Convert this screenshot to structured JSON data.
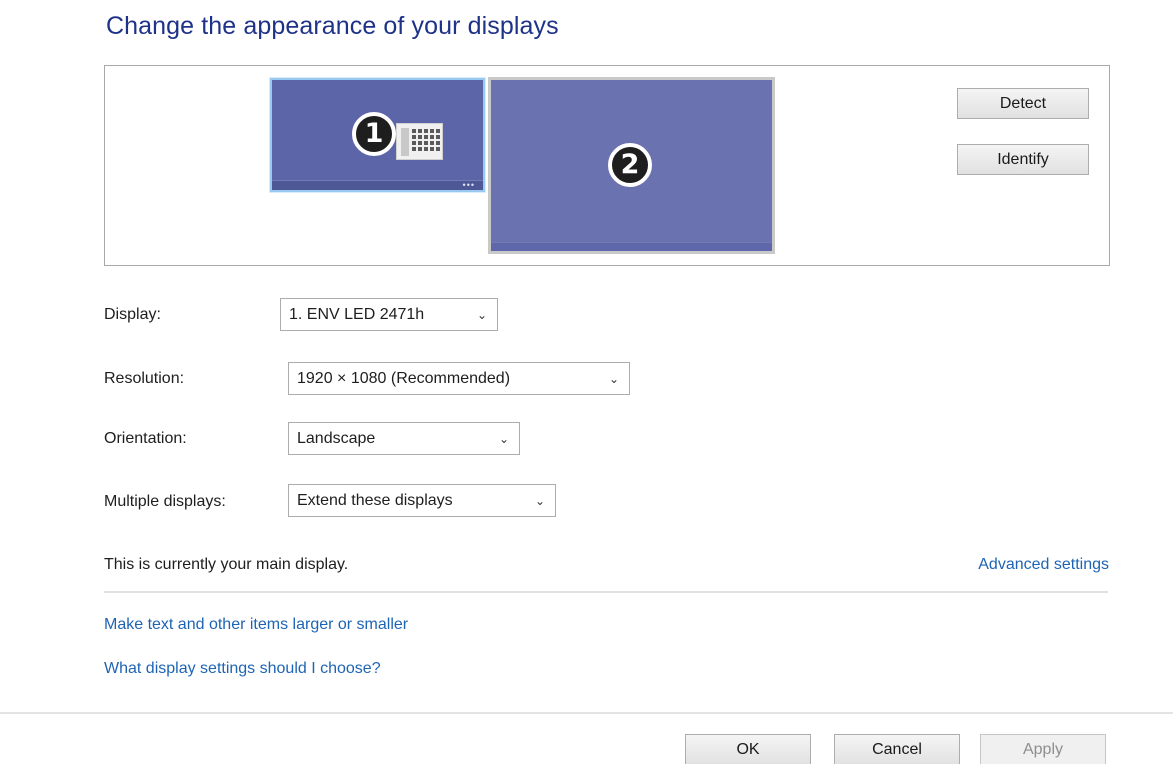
{
  "header": {
    "title": "Change the appearance of your displays"
  },
  "preview": {
    "monitor1_number": "1",
    "monitor2_number": "2",
    "taskbar_dots": "•••",
    "detect_label": "Detect",
    "identify_label": "Identify"
  },
  "form": {
    "display_label": "Display:",
    "display_value": "1. ENV LED 2471h",
    "resolution_label": "Resolution:",
    "resolution_value": "1920 × 1080 (Recommended)",
    "orientation_label": "Orientation:",
    "orientation_value": "Landscape",
    "multiple_label": "Multiple displays:",
    "multiple_value": "Extend these displays"
  },
  "status_text": "This is currently your main display.",
  "links": {
    "advanced": "Advanced settings",
    "text_size": "Make text and other items larger or smaller",
    "help": "What display settings should I choose?"
  },
  "footer": {
    "ok": "OK",
    "cancel": "Cancel",
    "apply": "Apply"
  },
  "icons": {
    "dropdown": "chevron-down-icon",
    "calculator": "calculator-icon"
  },
  "colors": {
    "title": "#1e3287",
    "link": "#1e64b4",
    "monitor": "#5c65a7",
    "selected_border": "#99c9ef"
  }
}
